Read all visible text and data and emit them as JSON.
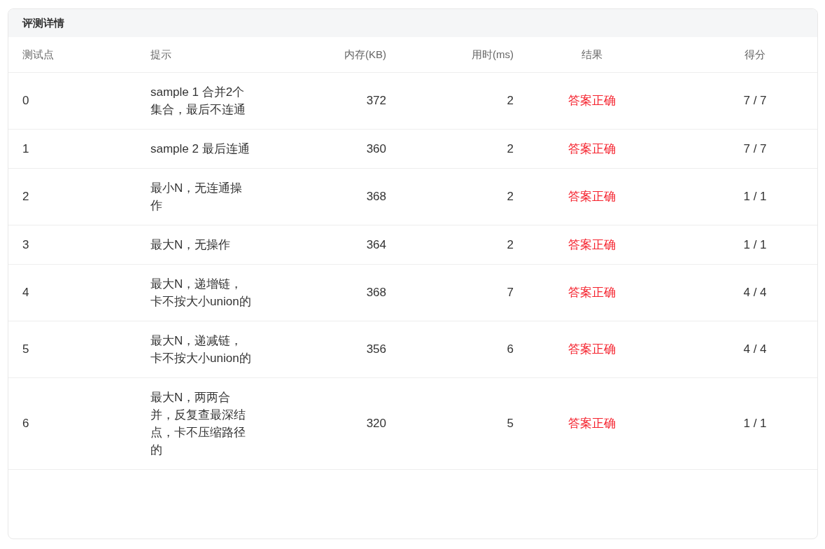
{
  "panel": {
    "title": "评测详情"
  },
  "table": {
    "columns": [
      "测试点",
      "提示",
      "内存(KB)",
      "用时(ms)",
      "结果",
      "得分"
    ],
    "rows": [
      {
        "case": "0",
        "hint": "sample 1 合并2个集合，最后不连通",
        "memory": "372",
        "time": "2",
        "result": "答案正确",
        "score": "7 / 7"
      },
      {
        "case": "1",
        "hint": "sample 2 最后连通",
        "memory": "360",
        "time": "2",
        "result": "答案正确",
        "score": "7 / 7"
      },
      {
        "case": "2",
        "hint": "最小N，无连通操作",
        "memory": "368",
        "time": "2",
        "result": "答案正确",
        "score": "1 / 1"
      },
      {
        "case": "3",
        "hint": "最大N，无操作",
        "memory": "364",
        "time": "2",
        "result": "答案正确",
        "score": "1 / 1"
      },
      {
        "case": "4",
        "hint": "最大N，递增链，卡不按大小union的",
        "memory": "368",
        "time": "7",
        "result": "答案正确",
        "score": "4 / 4"
      },
      {
        "case": "5",
        "hint": "最大N，递减链，卡不按大小union的",
        "memory": "356",
        "time": "6",
        "result": "答案正确",
        "score": "4 / 4"
      },
      {
        "case": "6",
        "hint": "最大N，两两合并，反复查最深结点，卡不压缩路径的",
        "memory": "320",
        "time": "5",
        "result": "答案正确",
        "score": "1 / 1"
      }
    ]
  }
}
